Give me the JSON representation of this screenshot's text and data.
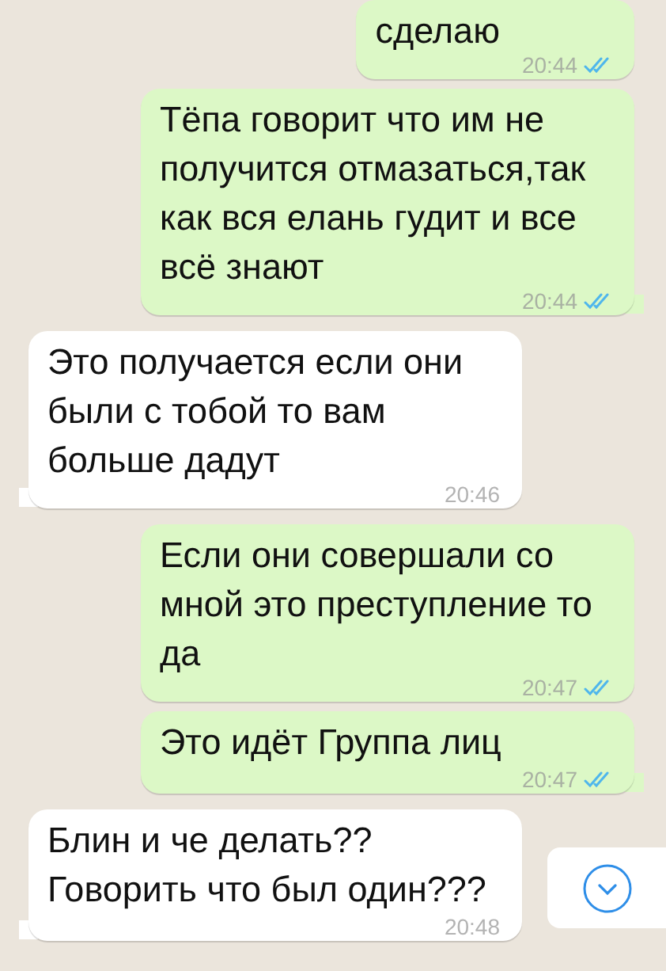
{
  "messages": [
    {
      "kind": "out",
      "text": "сделаю",
      "time": "20:44",
      "read": true,
      "tail": false
    },
    {
      "kind": "out",
      "text": "Тёпа говорит что им не получится отмазаться,так как вся елань гудит и все всё знают",
      "time": "20:44",
      "read": true,
      "tail": true
    },
    {
      "kind": "in",
      "text": "Это получается если они были с тобой то вам больше дадут",
      "time": "20:46",
      "tail": true
    },
    {
      "kind": "out",
      "text": "Если они совершали со мной это преступление то да",
      "time": "20:47",
      "read": true,
      "tail": false
    },
    {
      "kind": "out",
      "text": "Это идёт Группа лиц",
      "time": "20:47",
      "read": true,
      "tail": true
    },
    {
      "kind": "in",
      "text": "Блин и че делать??\nГоворить что был один???",
      "time": "20:48",
      "tail": true
    }
  ],
  "scroll_down_button": {
    "shown": true
  }
}
